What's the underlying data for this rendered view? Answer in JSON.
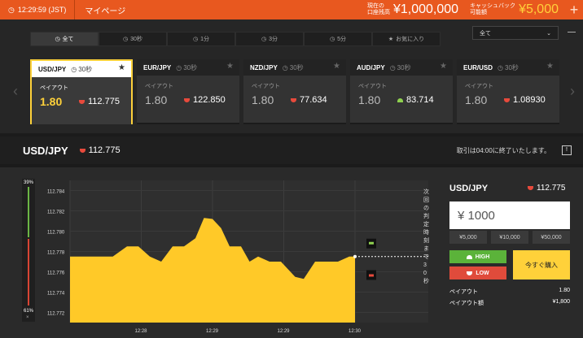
{
  "topbar": {
    "time": "12:29:59 (JST)",
    "mypage": "マイページ",
    "balance_label_1": "現在の",
    "balance_label_2": "口座残高",
    "balance": "¥1,000,000",
    "cashback_label_1": "キャッシュバック",
    "cashback_label_2": "可能額",
    "cashback": "¥5,000",
    "plus": "+"
  },
  "tabs": [
    {
      "label": "全て"
    },
    {
      "label": "30秒"
    },
    {
      "label": "1分"
    },
    {
      "label": "3分"
    },
    {
      "label": "5分"
    },
    {
      "label": "お気に入り"
    }
  ],
  "filter_select": "全て",
  "cards": [
    {
      "pair": "USD/JPY",
      "timer": "30秒",
      "payout_label": "ペイアウト",
      "payout": "1.80",
      "rate": "112.775",
      "dir": "down"
    },
    {
      "pair": "EUR/JPY",
      "timer": "30秒",
      "payout_label": "ペイアウト",
      "payout": "1.80",
      "rate": "122.850",
      "dir": "down"
    },
    {
      "pair": "NZD/JPY",
      "timer": "30秒",
      "payout_label": "ペイアウト",
      "payout": "1.80",
      "rate": "77.634",
      "dir": "down"
    },
    {
      "pair": "AUD/JPY",
      "timer": "30秒",
      "payout_label": "ペイアウト",
      "payout": "1.80",
      "rate": "83.714",
      "dir": "up"
    },
    {
      "pair": "EUR/USD",
      "timer": "30秒",
      "payout_label": "ペイアウト",
      "payout": "1.80",
      "rate": "1.08930",
      "dir": "down"
    }
  ],
  "info": {
    "pair": "USD/JPY",
    "rate": "112.775",
    "message": "取引は04:00に終了いたします。"
  },
  "gauge": {
    "high_pct": "39%",
    "low_pct": "61%",
    "close": "×",
    "high_fraction": 0.39
  },
  "side": {
    "pair": "USD/JPY",
    "rate": "112.775",
    "amount": "¥ 1000",
    "quick": [
      "¥5,000",
      "¥10,000",
      "¥50,000"
    ],
    "high": "HIGH",
    "low": "LOW",
    "buy": "今すぐ購入",
    "payout_label": "ペイアウト",
    "payout": "1.80",
    "payout_amount_label": "ペイアウト額",
    "payout_amount": "¥1,800"
  },
  "chart_data": {
    "type": "area",
    "y_ticks": [
      "112.784",
      "112.782",
      "112.780",
      "112.778",
      "112.776",
      "112.774",
      "112.772"
    ],
    "x_ticks": [
      "12:28",
      "12:29",
      "12:29",
      "12:30"
    ],
    "ylim": [
      112.771,
      112.785
    ],
    "x": [
      0,
      8,
      15,
      20,
      24,
      28,
      32,
      36,
      40,
      44,
      47,
      50,
      53,
      56,
      60,
      63,
      66,
      70,
      74,
      79,
      82,
      86,
      90,
      94,
      98,
      100
    ],
    "values": [
      112.7775,
      112.7775,
      112.7775,
      112.7785,
      112.7785,
      112.7775,
      112.777,
      112.7785,
      112.7785,
      112.7793,
      112.7813,
      112.7812,
      112.7803,
      112.7785,
      112.7785,
      112.777,
      112.7775,
      112.777,
      112.777,
      112.7755,
      112.7753,
      112.777,
      112.777,
      112.777,
      112.7775,
      112.7775
    ],
    "current_line": 112.7775,
    "side_note": "次回の判定時刻まで30秒"
  }
}
